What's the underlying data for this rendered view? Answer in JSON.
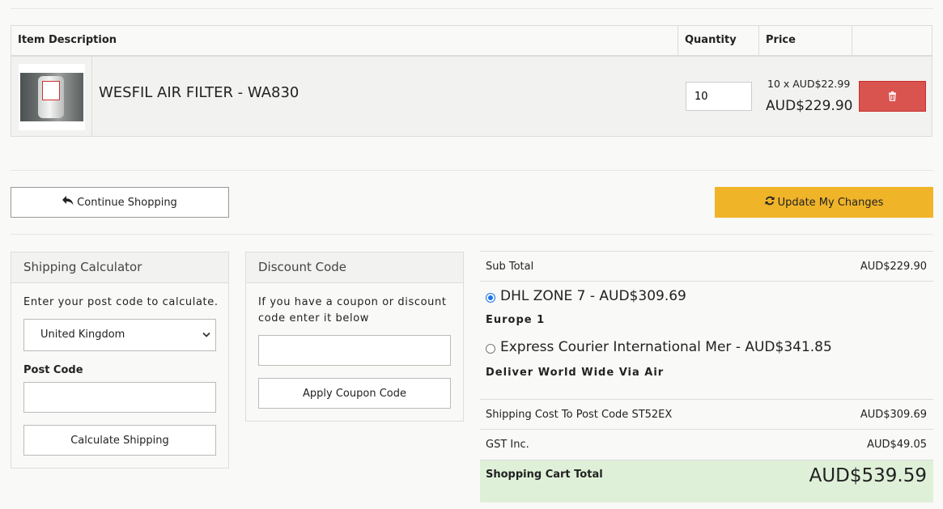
{
  "cart": {
    "headers": {
      "item": "Item Description",
      "quantity": "Quantity",
      "price": "Price"
    },
    "item": {
      "name": "WESFIL AIR FILTER - WA830",
      "quantity": "10",
      "unit_price": "10 x AUD$22.99",
      "line_total": "AUD$229.90"
    }
  },
  "actions": {
    "continue_label": "Continue Shopping",
    "update_label": "Update My Changes"
  },
  "shipping_calc": {
    "title": "Shipping Calculator",
    "instruction": "Enter your post code to calculate.",
    "country": "United Kingdom",
    "postcode_label": "Post Code",
    "button": "Calculate Shipping"
  },
  "discount": {
    "title": "Discount Code",
    "instruction": "If you have a coupon or discount code enter it below",
    "button": "Apply Coupon Code"
  },
  "totals": {
    "subtotal_label": "Sub Total",
    "subtotal": "AUD$229.90",
    "options": [
      {
        "label": "DHL ZONE 7 - AUD$309.69",
        "note": "Europe 1",
        "selected": true
      },
      {
        "label": "Express Courier International Mer - AUD$341.85",
        "note": "Deliver World Wide Via Air",
        "selected": false
      }
    ],
    "shipping_label": "Shipping Cost To Post Code ST52EX",
    "shipping": "AUD$309.69",
    "gst_label": "GST Inc.",
    "gst": "AUD$49.05",
    "grand_label": "Shopping Cart Total",
    "grand": "AUD$539.59"
  },
  "colors": {
    "update": "#f0b429",
    "delete": "#d9534f",
    "total_bg": "#dff0d8",
    "radio": "#1a73e8"
  }
}
